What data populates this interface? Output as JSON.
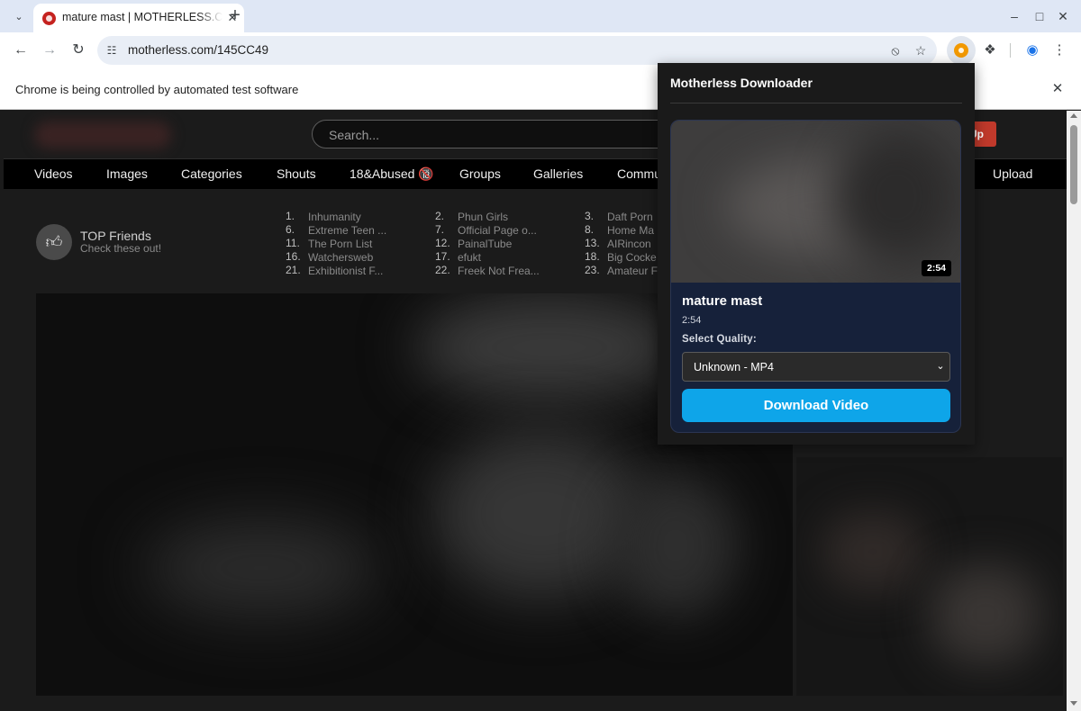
{
  "browser": {
    "tab_title": "mature mast | MOTHERLESS.COM",
    "new_tab": "+",
    "url": "motherless.com/145CC49",
    "infobar_text": "Chrome is being controlled by automated test software"
  },
  "icons": {
    "tab_search": "chevron-down-icon",
    "back": "arrow-left-icon",
    "forward": "arrow-right-icon",
    "reload": "reload-icon",
    "site_info": "tune-icon",
    "eye_off": "eye-off-icon",
    "bookmark": "star-icon",
    "extension": "puzzle-icon",
    "profile": "profile-icon",
    "menu": "kebab-menu-icon"
  },
  "site": {
    "search_placeholder": "Search...",
    "signup_label": "Up",
    "nav": [
      "Videos",
      "Images",
      "Categories",
      "Shouts",
      "18&Abused 🔞",
      "Groups",
      "Galleries",
      "Community",
      "Upload"
    ],
    "friends": {
      "title": "TOP Friends",
      "subtitle": "Check these out!",
      "columns": [
        [
          {
            "num": "1.",
            "name": "Inhumanity"
          },
          {
            "num": "6.",
            "name": "Extreme Teen ..."
          },
          {
            "num": "11.",
            "name": "The Porn List"
          },
          {
            "num": "16.",
            "name": "Watchersweb"
          },
          {
            "num": "21.",
            "name": "Exhibitionist F..."
          }
        ],
        [
          {
            "num": "2.",
            "name": "Phun Girls"
          },
          {
            "num": "7.",
            "name": "Official Page o..."
          },
          {
            "num": "12.",
            "name": "PainalTube"
          },
          {
            "num": "17.",
            "name": "efukt"
          },
          {
            "num": "22.",
            "name": "Freek Not Frea..."
          }
        ],
        [
          {
            "num": "3.",
            "name": "Daft Porn"
          },
          {
            "num": "8.",
            "name": "Home Ma"
          },
          {
            "num": "13.",
            "name": "AIRincon"
          },
          {
            "num": "18.",
            "name": "Big Cocke"
          },
          {
            "num": "23.",
            "name": "Amateur F"
          }
        ]
      ]
    }
  },
  "popup": {
    "title": "Motherless Downloader",
    "video_title": "mature mast",
    "duration_badge": "2:54",
    "duration_text": "2:54",
    "quality_label": "Select Quality:",
    "quality_selected": "Unknown - MP4",
    "download_label": "Download Video",
    "accent_color": "#0ea5e9"
  }
}
